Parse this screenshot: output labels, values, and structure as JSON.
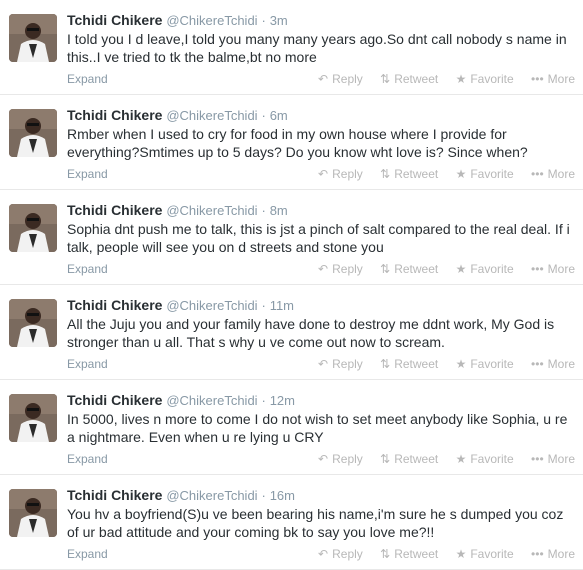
{
  "tweets": [
    {
      "fullname": "Tchidi Chikere",
      "username": "@ChikereTchidi",
      "separator": "·",
      "time": "3m",
      "text": "I told you I d leave,I told you many many years ago.So dnt call nobody s name in this..I ve tried to tk the balme,bt no more",
      "expand": "Expand",
      "reply": "Reply",
      "retweet": "Retweet",
      "favorite": "Favorite",
      "more": "More"
    },
    {
      "fullname": "Tchidi Chikere",
      "username": "@ChikereTchidi",
      "separator": "·",
      "time": "6m",
      "text": "Rmber when I used to cry for food  in my own house where I provide for everything?Smtimes up to 5 days? Do you know wht love is? Since when?",
      "expand": "Expand",
      "reply": "Reply",
      "retweet": "Retweet",
      "favorite": "Favorite",
      "more": "More"
    },
    {
      "fullname": "Tchidi Chikere",
      "username": "@ChikereTchidi",
      "separator": "·",
      "time": "8m",
      "text": "Sophia dnt push me to talk, this is jst a pinch of salt compared to the real deal. If i talk, people will see you on d streets and stone you",
      "expand": "Expand",
      "reply": "Reply",
      "retweet": "Retweet",
      "favorite": "Favorite",
      "more": "More"
    },
    {
      "fullname": "Tchidi Chikere",
      "username": "@ChikereTchidi",
      "separator": "·",
      "time": "11m",
      "text": "All the Juju you and your family have done to destroy me ddnt work, My God is stronger than u all. That s why u ve come out now to scream.",
      "expand": "Expand",
      "reply": "Reply",
      "retweet": "Retweet",
      "favorite": "Favorite",
      "more": "More"
    },
    {
      "fullname": "Tchidi Chikere",
      "username": "@ChikereTchidi",
      "separator": "·",
      "time": "12m",
      "text": "In 5000, lives n more to come I do not wish to set meet anybody like Sophia, u re a nightmare. Even when u re lying u CRY",
      "expand": "Expand",
      "reply": "Reply",
      "retweet": "Retweet",
      "favorite": "Favorite",
      "more": "More"
    },
    {
      "fullname": "Tchidi Chikere",
      "username": "@ChikereTchidi",
      "separator": "·",
      "time": "16m",
      "text": "You hv a boyfriend(S)u ve been bearing his name,i'm sure he s dumped you coz of ur bad attitude and your coming bk to say you love me?!!",
      "expand": "Expand",
      "reply": "Reply",
      "retweet": "Retweet",
      "favorite": "Favorite",
      "more": "More"
    }
  ],
  "icons": {
    "reply": "reply-icon",
    "retweet": "retweet-icon",
    "favorite": "star-icon",
    "more": "more-dots-icon"
  },
  "colors": {
    "name": "#292f33",
    "meta": "#8899a6",
    "action": "#b8b8b8",
    "divider": "#e8e8e8"
  }
}
